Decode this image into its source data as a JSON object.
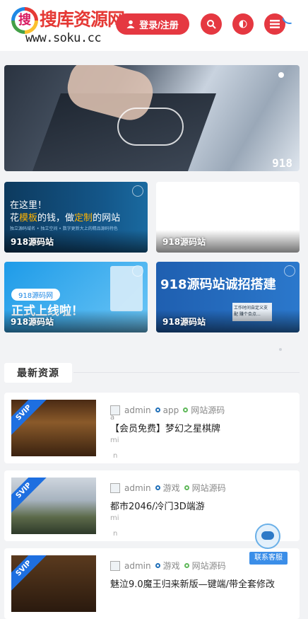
{
  "header": {
    "logo_cn": "搜库资源网",
    "logo_en": "www.soku.cc",
    "logo_badge": "搜",
    "login_label": "登录/注册",
    "icons": [
      "user-icon",
      "search-icon",
      "theme-icon",
      "menu-icon"
    ]
  },
  "hero": {
    "number": "918"
  },
  "cards": [
    {
      "caption": "918源码站",
      "line1": "在这里！",
      "line2_a": "花",
      "line2_b": "模板",
      "line2_c": "的钱，做",
      "line2_d": "定制",
      "line2_e": "的网站",
      "small": "独立源码域名 • 独立空间 • 数字更新大上的精品源码特色"
    },
    {
      "caption": "918源码站"
    },
    {
      "caption": "918源码站",
      "pill": "918源码网",
      "big": "正式上线啦！"
    },
    {
      "caption": "918源码站",
      "big": "918源码站诚招搭建",
      "box": "工作时间自定义支配 赚个合点…"
    }
  ],
  "section": {
    "title": "最新资源"
  },
  "items": [
    {
      "author": "admin",
      "tag1": "app",
      "tag2": "网站源码",
      "title": "【会员免费】梦幻之星棋牌",
      "ex1": "mi",
      "ex2": "n",
      "ribbon": "SVIP",
      "alt_prefix": "a"
    },
    {
      "author": "admin",
      "tag1": "游戏",
      "tag2": "网站源码",
      "title": "都市2046/冷门3D端游",
      "ex1": "mi",
      "ex2": "n",
      "ribbon": "SVIP"
    },
    {
      "author": "admin",
      "tag1": "游戏",
      "tag2": "网站源码",
      "title": "魅泣9.0魔王归来新版—键端/带全套修改",
      "ribbon": "SVIP"
    }
  ],
  "float": {
    "service_label": "联系客服"
  },
  "colors": {
    "accent": "#e53841",
    "link_blue": "#1f6fb8",
    "tag_green": "#5fb85a"
  }
}
